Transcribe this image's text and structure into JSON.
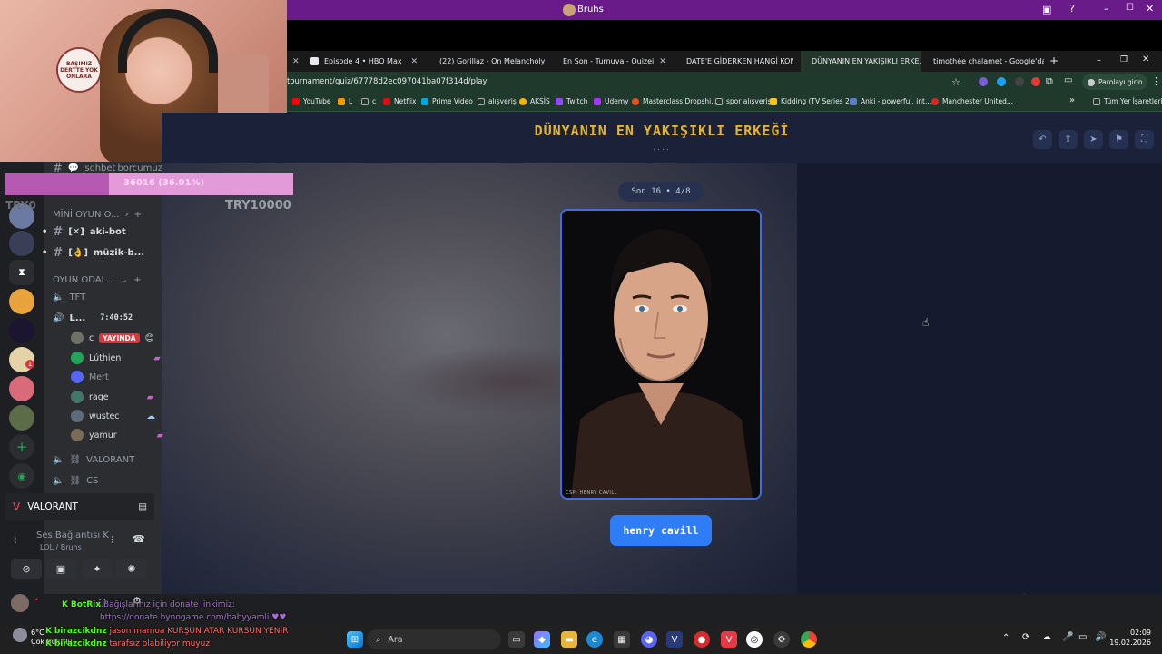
{
  "window": {
    "title": "Bruhs"
  },
  "webcam": {
    "sign_text": "BAŞIMIZ DERTTE YOK ONLARA"
  },
  "discord": {
    "top_channel": "sohbet",
    "top_channel_overlay": "borcumuz",
    "categories": {
      "mini_games": "MİNİ OYUN O...",
      "game_rooms": "OYUN ODAL..."
    },
    "text_channels": [
      {
        "prefix": "[✕]",
        "name": "aki-bot"
      },
      {
        "prefix": "[👌]",
        "name": "müzik-b..."
      }
    ],
    "voice_channels": [
      {
        "name": "TFT"
      },
      {
        "name": "L...",
        "timer": "7:40:52"
      },
      {
        "name": "VALORANT"
      },
      {
        "name": "CS"
      }
    ],
    "voice_users": [
      {
        "name": "c",
        "badge": "YAYINDA"
      },
      {
        "name": "Lúthien"
      },
      {
        "name": "Mert"
      },
      {
        "name": "rage"
      },
      {
        "name": "wustec"
      },
      {
        "name": "yamur"
      }
    ],
    "activity": "VALORANT",
    "connection": {
      "status": "Ses Bağlantısı K",
      "channel": "LOL / Bruhs"
    },
    "server_badge": "1"
  },
  "donation": {
    "progress_text": "36016 (36.01%)",
    "progress_pct": 36.01,
    "left_amount": "TRY0",
    "goal": "TRY10000"
  },
  "chat": [
    {
      "user": "BotRix",
      "text": "Bağışlarınız için donate linkimiz:"
    },
    {
      "user": "",
      "text": "https://donate.bynogame.com/babyyamli ♥♥"
    },
    {
      "user": "birazcikdnz",
      "text": "jason mamoa KURŞUN ATAR KURSUN YENİR"
    },
    {
      "user": "birazcikdnz",
      "text": "tarafsız olabiliyor muyuz"
    }
  ],
  "browser": {
    "tabs": [
      {
        "label": "",
        "active": false
      },
      {
        "label": "Episode 4 • HBO Max",
        "active": false,
        "color": "#e8eaed"
      },
      {
        "label": "(22) Gorillaz - On Melancholy H",
        "active": false,
        "color": "#ff0000"
      },
      {
        "label": "En Son - Turnuva - Quizei",
        "active": false,
        "color": "#4aa3ff"
      },
      {
        "label": "DATE'E GİDERKEN HANGİ KOMB",
        "active": false,
        "color": "#f0c419"
      },
      {
        "label": "DÜNYANIN EN YAKIŞIKLI ERKE...",
        "active": true,
        "color": "#f0c419"
      },
      {
        "label": "timothée chalamet - Google'da",
        "active": false,
        "color": "#34a853"
      }
    ],
    "url": "tournament/quiz/67778d2ec097041ba07f314d/play",
    "profile_button": "Parolayı girin",
    "bookmarks": [
      {
        "label": "YouTube",
        "color": "#ff0000"
      },
      {
        "label": "L",
        "color": "#f29900"
      },
      {
        "label": "c",
        "color": "#aaaaaa"
      },
      {
        "label": "Netflix",
        "color": "#e50914"
      },
      {
        "label": "Prime Video",
        "color": "#00a8e1"
      },
      {
        "label": "alışveriş",
        "color": "#aaaaaa"
      },
      {
        "label": "AKSİS",
        "color": "#f4b400"
      },
      {
        "label": "Twitch",
        "color": "#9146ff"
      },
      {
        "label": "Udemy",
        "color": "#a435f0"
      },
      {
        "label": "Masterclass Dropshi...",
        "color": "#e94e1b"
      },
      {
        "label": "spor alışveriş",
        "color": "#aaaaaa"
      },
      {
        "label": "Kidding (TV Series 2...",
        "color": "#f5c518"
      },
      {
        "label": "Anki - powerful, int...",
        "color": "#5b7ec2"
      },
      {
        "label": "Manchester United...",
        "color": "#da291c"
      }
    ],
    "all_bookmarks": "Tüm Yer İşaretleri"
  },
  "quiz": {
    "title": "DÜNYANIN EN YAKIŞIKLI ERKEĞİ",
    "title_dots": "....",
    "round": "Son 16 • 4/8",
    "photo_credit": "CSP: HENRY CAVILL",
    "answer": "henry cavill",
    "accent": "#2e7cf6",
    "title_color": "#e3b52f"
  },
  "taskbar": {
    "search_placeholder": "Ara",
    "weather_temp": "6°C",
    "weather_desc": "Çok bulutlu",
    "time": "02:09",
    "date": "19.02.2026"
  }
}
